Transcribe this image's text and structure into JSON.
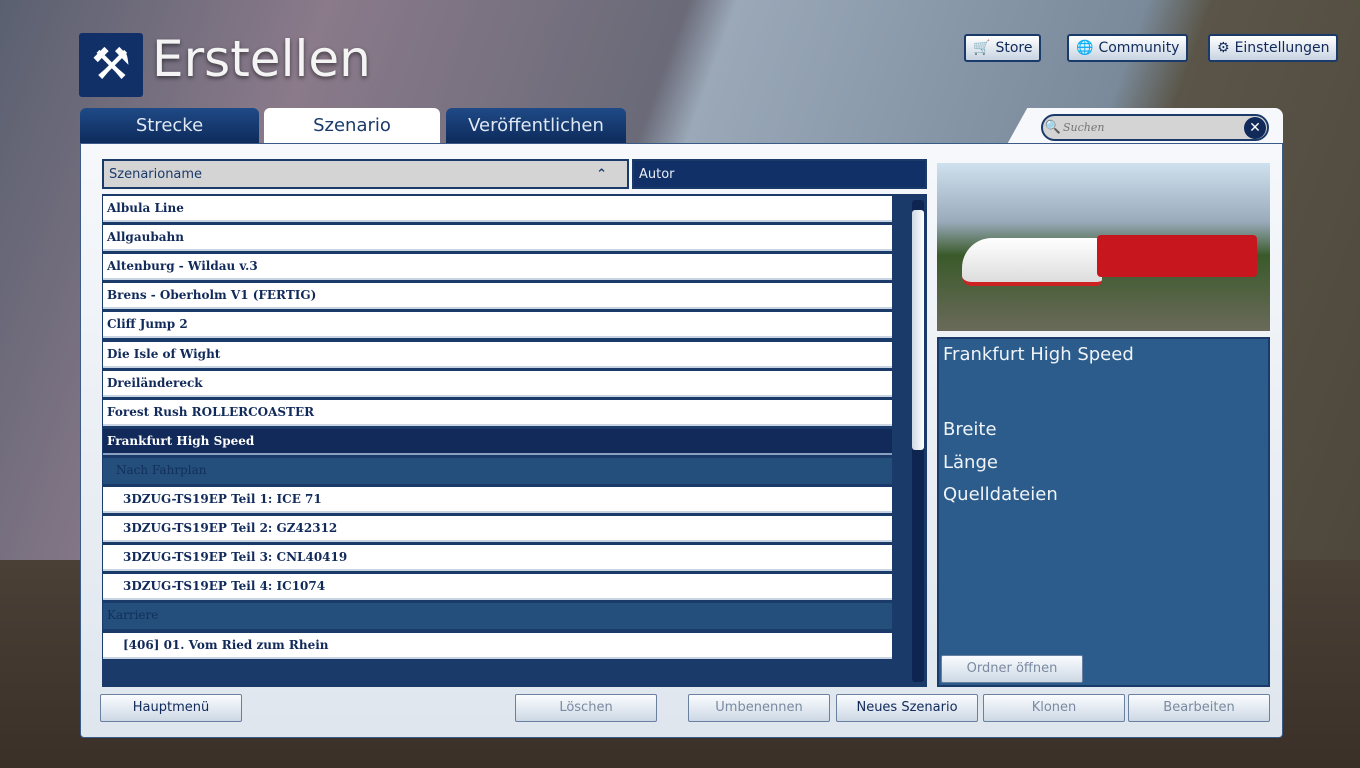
{
  "header": {
    "title": "Erstellen",
    "logo_icon": "hammer-track-icon"
  },
  "top_buttons": [
    {
      "label": "Store",
      "icon": "cart-icon"
    },
    {
      "label": "Community",
      "icon": "globe-icon"
    },
    {
      "label": "Einstellungen",
      "icon": "gear-icon"
    }
  ],
  "tabs": [
    {
      "label": "Strecke"
    },
    {
      "label": "Szenario",
      "active": true
    },
    {
      "label": "Veröffentlichen"
    }
  ],
  "search": {
    "placeholder": "Suchen",
    "value": ""
  },
  "columns": {
    "name": "Szenarioname",
    "author": "Autor"
  },
  "rows": [
    {
      "label": "Albula Line",
      "type": "item"
    },
    {
      "label": "Allgaubahn",
      "type": "item"
    },
    {
      "label": "Altenburg - Wildau v.3",
      "type": "item"
    },
    {
      "label": "Brens - Oberholm V1 (FERTIG)",
      "type": "item"
    },
    {
      "label": "Cliff Jump 2",
      "type": "item"
    },
    {
      "label": "Die Isle of Wight",
      "type": "item"
    },
    {
      "label": "Dreiländereck",
      "type": "item"
    },
    {
      "label": "Forest Rush ROLLERCOASTER",
      "type": "item"
    },
    {
      "label": "Frankfurt High Speed",
      "type": "selected"
    },
    {
      "label": "Nach Fahrplan",
      "type": "group"
    },
    {
      "label": "3DZUG-TS19EP Teil 1: ICE 71",
      "type": "sub"
    },
    {
      "label": "3DZUG-TS19EP Teil 2: GZ42312",
      "type": "sub"
    },
    {
      "label": "3DZUG-TS19EP Teil 3: CNL40419",
      "type": "sub"
    },
    {
      "label": "3DZUG-TS19EP Teil 4: IC1074",
      "type": "sub"
    },
    {
      "label": "Karriere",
      "type": "group"
    },
    {
      "label": "[406] 01. Vom Ried zum Rhein",
      "type": "sub"
    }
  ],
  "details": {
    "title": "Frankfurt High Speed",
    "breite": "Breite",
    "laenge": "Länge",
    "quelldateien": "Quelldateien",
    "open_folder": "Ordner öffnen"
  },
  "buttons": {
    "main_menu": "Hauptmenü",
    "delete": "Löschen",
    "rename": "Umbenennen",
    "new": "Neues Szenario",
    "clone": "Klonen",
    "edit": "Bearbeiten"
  }
}
